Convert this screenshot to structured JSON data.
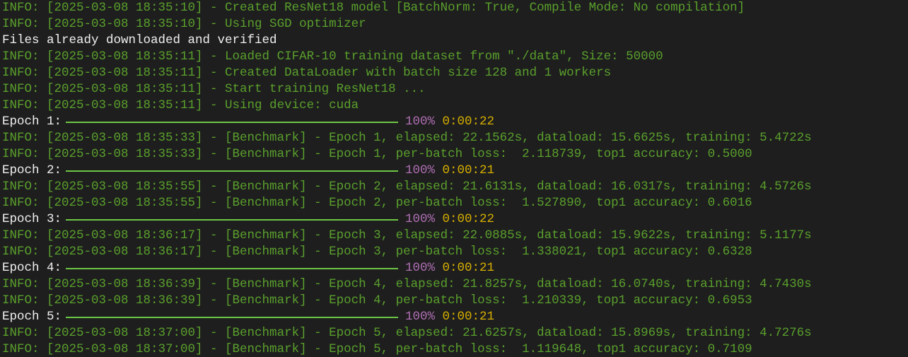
{
  "terminal": {
    "lines": [
      {
        "type": "log",
        "text": "INFO: [2025-03-08 18:35:10] - Created ResNet18 model [BatchNorm: True, Compile Mode: No compilation]"
      },
      {
        "type": "log",
        "text": "INFO: [2025-03-08 18:35:10] - Using SGD optimizer"
      },
      {
        "type": "plain",
        "text": "Files already downloaded and verified"
      },
      {
        "type": "log",
        "text": "INFO: [2025-03-08 18:35:11] - Loaded CIFAR-10 training dataset from \"./data\", Size: 50000"
      },
      {
        "type": "log",
        "text": "INFO: [2025-03-08 18:35:11] - Created DataLoader with batch size 128 and 1 workers"
      },
      {
        "type": "log",
        "text": "INFO: [2025-03-08 18:35:11] - Start training ResNet18 ..."
      },
      {
        "type": "log",
        "text": "INFO: [2025-03-08 18:35:11] - Using device: cuda"
      },
      {
        "type": "progress",
        "label": "Epoch 1:",
        "percent_text": "100%",
        "progress": 1.0,
        "time": "0:00:22"
      },
      {
        "type": "log",
        "text": "INFO: [2025-03-08 18:35:33] - [Benchmark] - Epoch 1, elapsed: 22.1562s, dataload: 15.6625s, training: 5.4722s"
      },
      {
        "type": "log",
        "text": "INFO: [2025-03-08 18:35:33] - [Benchmark] - Epoch 1, per-batch loss:  2.118739, top1 accuracy: 0.5000"
      },
      {
        "type": "progress",
        "label": "Epoch 2:",
        "percent_text": "100%",
        "progress": 1.0,
        "time": "0:00:21"
      },
      {
        "type": "log",
        "text": "INFO: [2025-03-08 18:35:55] - [Benchmark] - Epoch 2, elapsed: 21.6131s, dataload: 16.0317s, training: 4.5726s"
      },
      {
        "type": "log",
        "text": "INFO: [2025-03-08 18:35:55] - [Benchmark] - Epoch 2, per-batch loss:  1.527890, top1 accuracy: 0.6016"
      },
      {
        "type": "progress",
        "label": "Epoch 3:",
        "percent_text": "100%",
        "progress": 1.0,
        "time": "0:00:22"
      },
      {
        "type": "log",
        "text": "INFO: [2025-03-08 18:36:17] - [Benchmark] - Epoch 3, elapsed: 22.0885s, dataload: 15.9622s, training: 5.1177s"
      },
      {
        "type": "log",
        "text": "INFO: [2025-03-08 18:36:17] - [Benchmark] - Epoch 3, per-batch loss:  1.338021, top1 accuracy: 0.6328"
      },
      {
        "type": "progress",
        "label": "Epoch 4:",
        "percent_text": "100%",
        "progress": 1.0,
        "time": "0:00:21"
      },
      {
        "type": "log",
        "text": "INFO: [2025-03-08 18:36:39] - [Benchmark] - Epoch 4, elapsed: 21.8257s, dataload: 16.0740s, training: 4.7430s"
      },
      {
        "type": "log",
        "text": "INFO: [2025-03-08 18:36:39] - [Benchmark] - Epoch 4, per-batch loss:  1.210339, top1 accuracy: 0.6953"
      },
      {
        "type": "progress",
        "label": "Epoch 5:",
        "percent_text": "100%",
        "progress": 1.0,
        "time": "0:00:21"
      },
      {
        "type": "log",
        "text": "INFO: [2025-03-08 18:37:00] - [Benchmark] - Epoch 5, elapsed: 21.6257s, dataload: 15.8969s, training: 4.7276s"
      },
      {
        "type": "log",
        "text": "INFO: [2025-03-08 18:37:00] - [Benchmark] - Epoch 5, per-batch loss:  1.119648, top1 accuracy: 0.7109"
      }
    ]
  },
  "colors": {
    "background": "#1e1e1e",
    "log_text": "#5aa02c",
    "plain_text": "#f0f0f0",
    "progress_bar": "#6cc644",
    "percent": "#b06fb4",
    "time": "#d8b000"
  }
}
